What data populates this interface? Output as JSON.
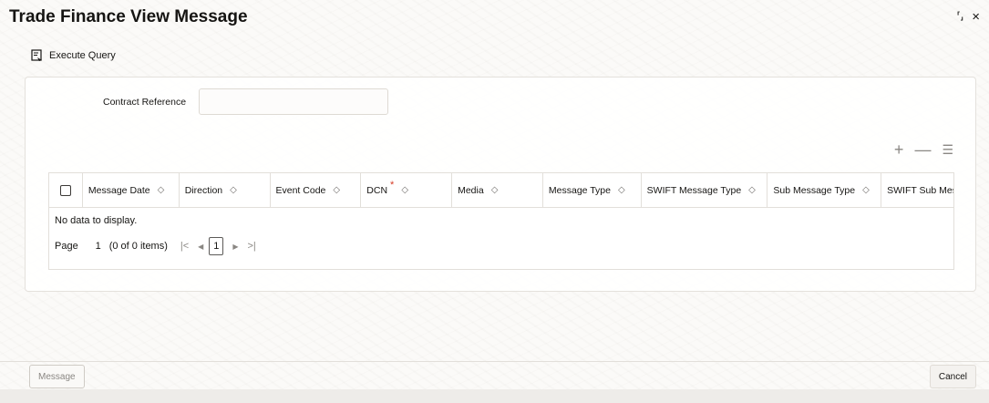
{
  "window": {
    "title": "Trade Finance View Message",
    "expand_glyph": "⸢⸥",
    "close_glyph": "×"
  },
  "toolbar": {
    "execute_query_label": "Execute Query"
  },
  "form": {
    "contract_reference_label": "Contract Reference",
    "contract_reference_value": "",
    "contract_reference_placeholder": ""
  },
  "grid_actions": {
    "add_glyph": "+",
    "remove_glyph": "—",
    "columns_glyph": "☰"
  },
  "grid": {
    "columns": [
      {
        "label": "Message Date",
        "sortable": true
      },
      {
        "label": "Direction",
        "sortable": true
      },
      {
        "label": "Event Code",
        "sortable": true
      },
      {
        "label": "DCN",
        "sortable": true,
        "required": true
      },
      {
        "label": "Media",
        "sortable": true
      },
      {
        "label": "Message Type",
        "sortable": true
      },
      {
        "label": "SWIFT Message Type",
        "sortable": true
      },
      {
        "label": "Sub Message Type",
        "sortable": true
      },
      {
        "label": "SWIFT Sub Messa",
        "sortable": false
      }
    ],
    "empty_text": "No data to display.",
    "sort_glyph": "◇",
    "required_glyph": "*"
  },
  "pagination": {
    "page_label": "Page",
    "page_value": "1",
    "count_text": "(0 of 0 items)",
    "first_glyph": "|<",
    "prev_glyph": "◀",
    "current_page": "1",
    "next_glyph": "▶",
    "last_glyph": ">|"
  },
  "footer": {
    "message_button": "Message",
    "cancel_button": "Cancel"
  },
  "colors": {
    "required": "#d63b25",
    "border": "#e2dfda",
    "muted": "#8a8783"
  }
}
